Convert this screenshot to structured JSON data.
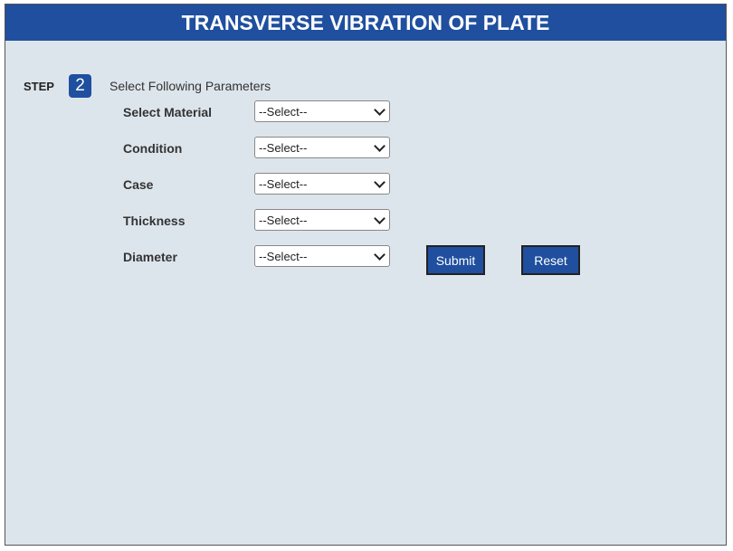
{
  "header": {
    "title": "TRANSVERSE VIBRATION OF PLATE"
  },
  "step": {
    "label": "STEP",
    "number": "2",
    "description": "Select Following Parameters"
  },
  "params": [
    {
      "label": "Select Material",
      "value": "--Select--"
    },
    {
      "label": "Condition",
      "value": "--Select--"
    },
    {
      "label": "Case",
      "value": "--Select--"
    },
    {
      "label": "Thickness",
      "value": "--Select--"
    },
    {
      "label": "Diameter",
      "value": "--Select--"
    }
  ],
  "buttons": {
    "submit": "Submit",
    "reset": "Reset"
  },
  "colors": {
    "primary": "#1f4f9e",
    "background": "#dde5ec"
  }
}
